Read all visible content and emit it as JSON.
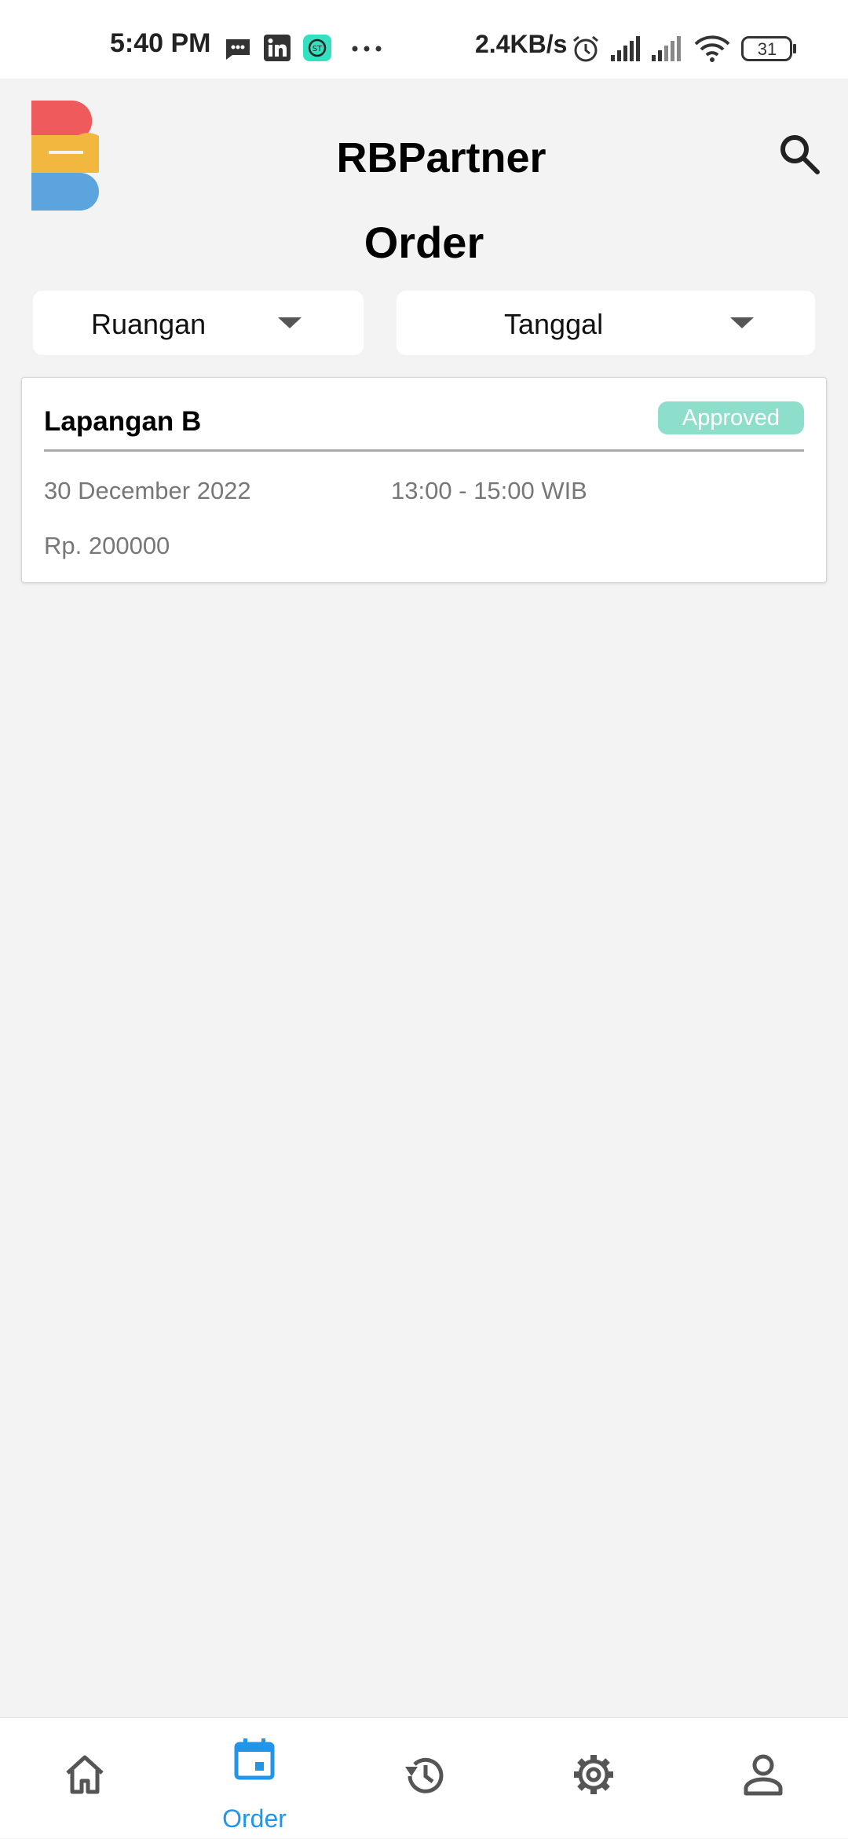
{
  "status_bar": {
    "time": "5:40 PM",
    "network_speed": "2.4KB/s",
    "battery_level": "31",
    "icons": [
      "message-icon",
      "linkedin-icon",
      "app-notification-icon",
      "more-icon",
      "alarm-icon",
      "signal-icon",
      "signal-icon",
      "wifi-icon",
      "battery-icon"
    ]
  },
  "header": {
    "app_title": "RBPartner",
    "page_title": "Order",
    "search_icon": "search-icon"
  },
  "filters": {
    "room": "Ruangan",
    "date": "Tanggal"
  },
  "orders": [
    {
      "venue": "Lapangan B",
      "status": "Approved",
      "date": "30 December 2022",
      "time": "13:00 - 15:00 WIB",
      "price": "Rp. 200000"
    }
  ],
  "bottom_nav": {
    "items": [
      {
        "icon": "home-icon",
        "label": ""
      },
      {
        "icon": "calendar-icon",
        "label": "Order",
        "active": true
      },
      {
        "icon": "history-icon",
        "label": ""
      },
      {
        "icon": "settings-icon",
        "label": ""
      },
      {
        "icon": "profile-icon",
        "label": ""
      }
    ]
  },
  "colors": {
    "accent": "#2196e8",
    "status_approved": "#8ddfcc",
    "background": "#f3f3f3"
  }
}
